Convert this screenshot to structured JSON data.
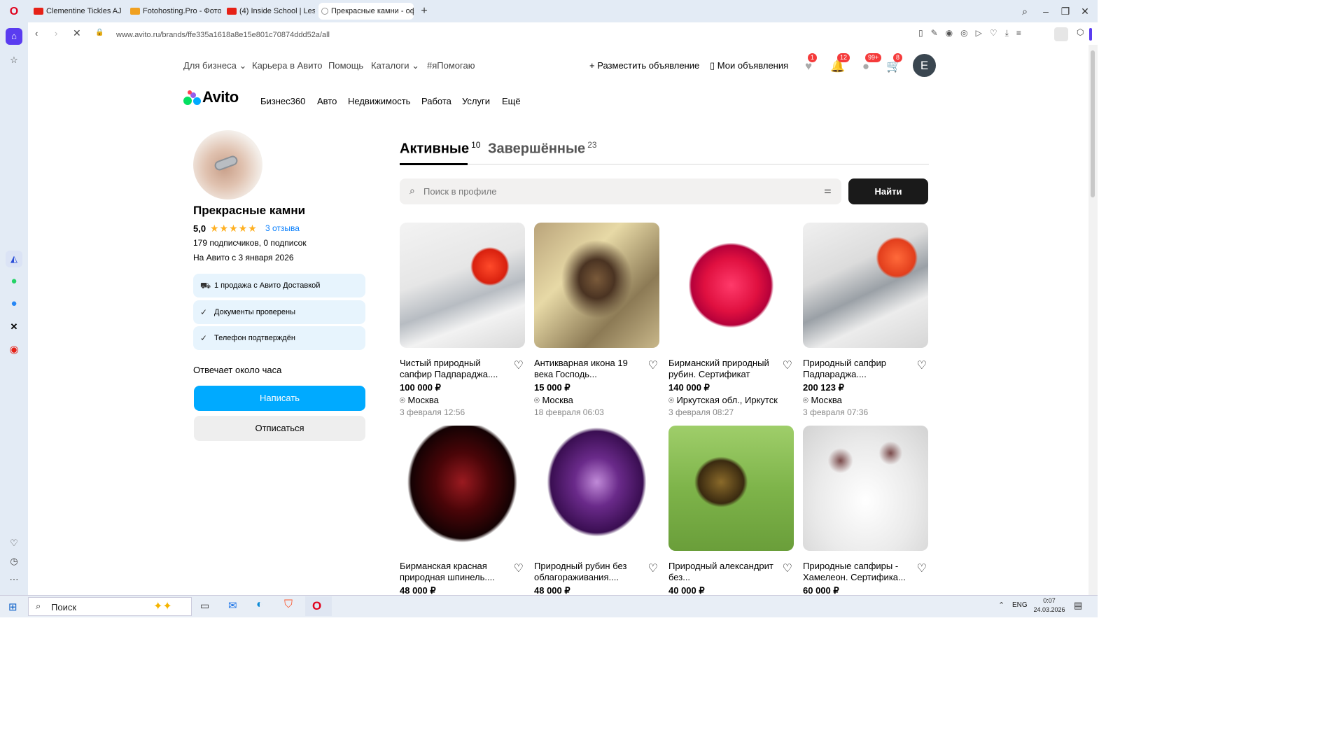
{
  "browser": {
    "tabs": [
      {
        "label": "Clementine Tickles AJ - Bc",
        "fav_color": "#e62117"
      },
      {
        "label": "Fotohosting.Pro - Фотохо",
        "fav_color": "#f0a020"
      },
      {
        "label": "(4) Inside School | Les",
        "fav_color": "#e62117"
      },
      {
        "label": "Прекрасные камни - оф",
        "fav_color": "#999999"
      }
    ],
    "new_tab": "+",
    "url": "www.avito.ru/brands/ffe335a1618a8e15e801c70874ddd52a/all",
    "logo": "O"
  },
  "topbar": {
    "links": [
      "Для бизнеса",
      "Карьера в Авито",
      "Помощь",
      "Каталоги",
      "#яПомогаю"
    ],
    "post_ad": "Разместить объявление",
    "my_ads": "Мои объявления",
    "badges": {
      "favorites": "1",
      "notifications": "12",
      "messages": "99+",
      "cart": "8"
    },
    "avatar_letter": "E"
  },
  "nav": {
    "logo": "Avito",
    "items": [
      "Бизнес360",
      "Авто",
      "Недвижимость",
      "Работа",
      "Услуги",
      "Ещё"
    ]
  },
  "profile": {
    "name": "Прекрасные камни",
    "rating": "5,0",
    "stars": "★★★★★",
    "reviews": "3 отзыва",
    "subscribers": "179 подписчиков, 0 подписок",
    "since": "На Авито с 3 января 2026",
    "pills": [
      "1 продажа с Авито Доставкой",
      "Документы проверены",
      "Телефон подтверждён"
    ],
    "response": "Отвечает около часа",
    "write_btn": "Написать",
    "unsub_btn": "Отписаться"
  },
  "tabs": {
    "active_label": "Активные",
    "active_count": "10",
    "done_label": "Завершённые",
    "done_count": "23"
  },
  "search": {
    "placeholder": "Поиск в профиле",
    "button": "Найти"
  },
  "listings": [
    {
      "title": "Чистый природный сапфир Падпараджа....",
      "price": "100 000 ₽",
      "loc": "Москва",
      "date": "3 февраля 12:56"
    },
    {
      "title": "Антикварная икона 19 века Господь...",
      "price": "15 000 ₽",
      "loc": "Москва",
      "date": "18 февраля 06:03"
    },
    {
      "title": "Бирманский природный рубин. Сертификат",
      "price": "140 000 ₽",
      "loc": "Иркутская обл., Иркутск",
      "date": "3 февраля 08:27"
    },
    {
      "title": "Природный сапфир Падпараджа....",
      "price": "200 123 ₽",
      "loc": "Москва",
      "date": "3 февраля 07:36"
    },
    {
      "title": "Бирманская красная природная шпинель....",
      "price": "48 000 ₽",
      "loc": "",
      "date": ""
    },
    {
      "title": "Природный рубин без облагораживания....",
      "price": "48 000 ₽",
      "loc": "",
      "date": ""
    },
    {
      "title": "Природный александрит без...",
      "price": "40 000 ₽",
      "loc": "",
      "date": ""
    },
    {
      "title": "Природные сапфиры - Хамелеон. Сертифика...",
      "price": "60 000 ₽",
      "loc": "",
      "date": ""
    }
  ],
  "taskbar": {
    "search": "Поиск",
    "lang": "ENG",
    "time": "0:07",
    "date": "24.03.2026"
  }
}
